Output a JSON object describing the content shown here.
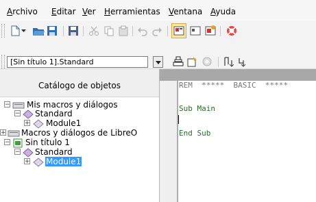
{
  "menu": [
    "Archivo",
    "Editar",
    "Ver",
    "Herramientas",
    "Ventana",
    "Ayuda"
  ],
  "library_selector": {
    "value": "[Sin título 1].Standard"
  },
  "catalog": {
    "title": "Catálogo de objetos",
    "tree": [
      {
        "label": "Mis macros y diálogos",
        "expander": "−",
        "icon": "macro-container-icon"
      },
      {
        "label": "Standard",
        "expander": "−",
        "icon": "library-icon"
      },
      {
        "label": "Module1",
        "expander": "+",
        "icon": "module-icon"
      },
      {
        "label": "Macros y diálogos de LibreO",
        "expander": "+",
        "icon": "macro-container-icon"
      },
      {
        "label": "Sin título 1",
        "expander": "−",
        "icon": "document-icon"
      },
      {
        "label": "Standard",
        "expander": "−",
        "icon": "library-icon"
      },
      {
        "label": "Module1",
        "expander": "+",
        "icon": "module-icon",
        "selected": true
      }
    ]
  },
  "editor": {
    "lines": [
      "REM  *****  BASIC  *****",
      "Sub Main",
      "End Sub"
    ]
  },
  "colors": {
    "keyword": "#276d27",
    "comment": "#777777",
    "selection": "#3399ff",
    "toggle_active": "#fbe7a6"
  }
}
